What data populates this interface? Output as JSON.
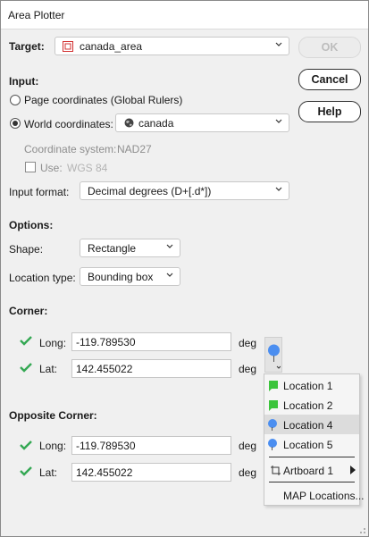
{
  "window": {
    "title": "Area Plotter"
  },
  "target": {
    "label": "Target:",
    "value": "canada_area"
  },
  "buttons": {
    "ok": "OK",
    "cancel": "Cancel",
    "help": "Help"
  },
  "input": {
    "heading": "Input:",
    "page_coords": "Page coordinates (Global Rulers)",
    "world_coords": "World coordinates:",
    "world_value": "canada",
    "coord_system_label": "Coordinate system:",
    "coord_system_value": "NAD27",
    "use_label": "Use:",
    "use_value": "WGS 84",
    "format_label": "Input format:",
    "format_value": "Decimal degrees (D+[.d*])"
  },
  "options": {
    "heading": "Options:",
    "shape_label": "Shape:",
    "shape_value": "Rectangle",
    "loctype_label": "Location type:",
    "loctype_value": "Bounding box"
  },
  "corner": {
    "heading": "Corner:",
    "long_label": "Long:",
    "long_value": "-119.789530",
    "lat_label": "Lat:",
    "lat_value": "142.455022",
    "unit": "deg"
  },
  "opposite": {
    "heading": "Opposite Corner:",
    "long_label": "Long:",
    "long_value": "-119.789530",
    "lat_label": "Lat:",
    "lat_value": "142.455022",
    "unit": "deg"
  },
  "menu": {
    "items": [
      {
        "label": "Location 1",
        "icon": "green-flag"
      },
      {
        "label": "Location 2",
        "icon": "green-flag"
      },
      {
        "label": "Location 4",
        "icon": "blue-pin"
      },
      {
        "label": "Location 5",
        "icon": "blue-pin"
      }
    ],
    "artboard": "Artboard 1",
    "map_locations": "MAP Locations..."
  }
}
